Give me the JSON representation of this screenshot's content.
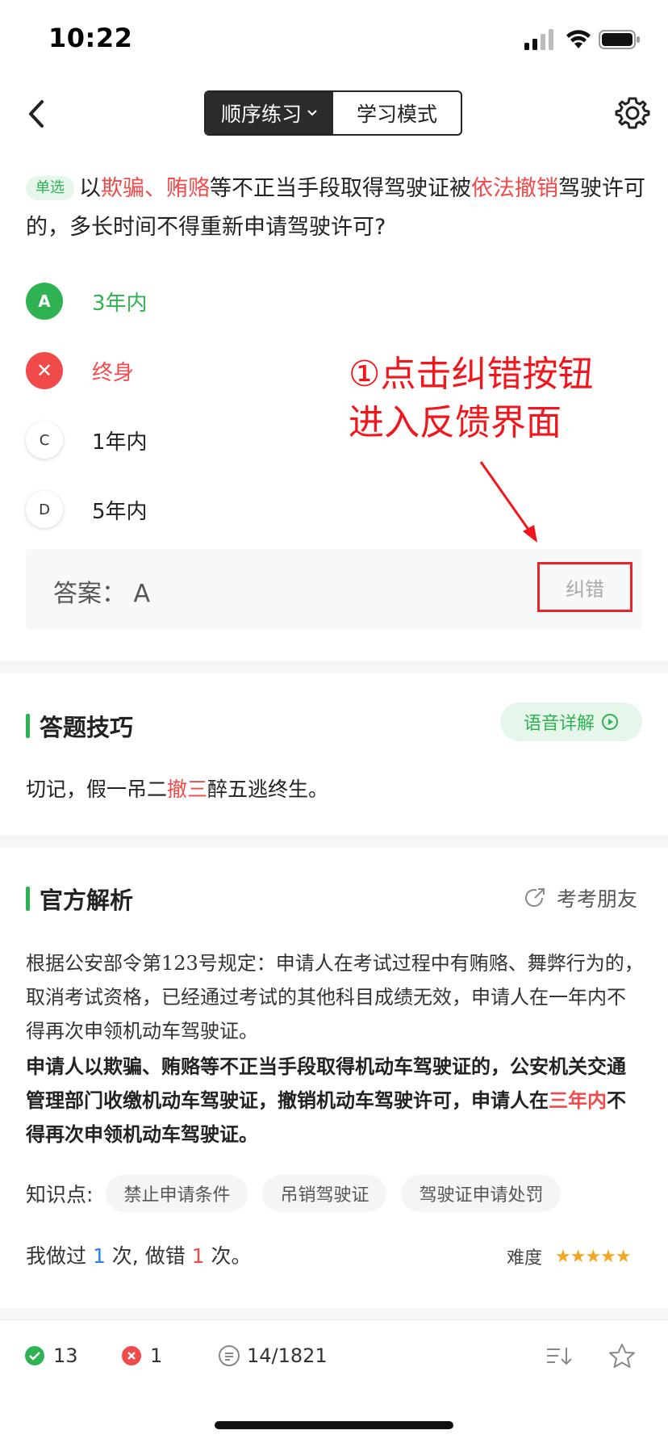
{
  "status_bar": {
    "time": "10:22"
  },
  "nav": {
    "mode_select": "顺序练习",
    "mode_tab": "学习模式"
  },
  "question": {
    "type_tag": "单选",
    "segments": [
      {
        "text": "以",
        "highlight": false
      },
      {
        "text": "欺骗、贿赂",
        "highlight": true
      },
      {
        "text": "等不正当手段取得驾驶证被",
        "highlight": false
      },
      {
        "text": "依法撤销",
        "highlight": true
      },
      {
        "text": "驾驶许可的，多长时间不得重新申请驾驶许可?",
        "highlight": false
      }
    ]
  },
  "options": [
    {
      "marker": "A",
      "text": "3年内",
      "state": "correct"
    },
    {
      "marker": "✕",
      "text": "终身",
      "state": "wrong"
    },
    {
      "marker": "C",
      "text": "1年内",
      "state": "plain"
    },
    {
      "marker": "D",
      "text": "5年内",
      "state": "plain"
    }
  ],
  "answer": {
    "text": "答案：  A",
    "report_label": "纠错"
  },
  "annotation": {
    "line1": "①点击纠错按钮",
    "line2": "进入反馈界面",
    "color": "#f0161c"
  },
  "tips": {
    "title": "答题技巧",
    "voice_label": "语音详解",
    "text_before": "切记，假一吊二",
    "text_highlight": "撤三",
    "text_after": "醉五逃终生。"
  },
  "analysis": {
    "title": "官方解析",
    "share_label": "考考朋友",
    "paragraph1": "根据公安部令第123号规定：申请人在考试过程中有贿赂、舞弊行为的，取消考试资格，已经通过考试的其他科目成绩无效，申请人在一年内不得再次申领机动车驾驶证。",
    "paragraph2_before": "申请人以欺骗、贿赂等不正当手段取得机动车驾驶证的，公安机关交通管理部门收缴机动车驾驶证，撤销机动车驾驶许可，申请人在",
    "paragraph2_highlight": "三年内",
    "paragraph2_after": "不得再次申领机动车驾驶证。"
  },
  "knowledge": {
    "label": "知识点:",
    "tags": [
      "禁止申请条件",
      "吊销驾驶证",
      "驾驶证申请处罚"
    ]
  },
  "record": {
    "prefix": "我做过 ",
    "done_count": "1",
    "middle": " 次, 做错 ",
    "wrong_count": "1",
    "suffix": " 次。",
    "difficulty_label": "难度",
    "stars": "★★★★★",
    "difficulty_rating": 5
  },
  "bottom_bar": {
    "correct_count": "13",
    "wrong_count": "1",
    "progress": "14/1821"
  },
  "colors": {
    "accent_green": "#2fb352",
    "error_red": "#f04a4a",
    "highlight_box": "#e8262a"
  }
}
